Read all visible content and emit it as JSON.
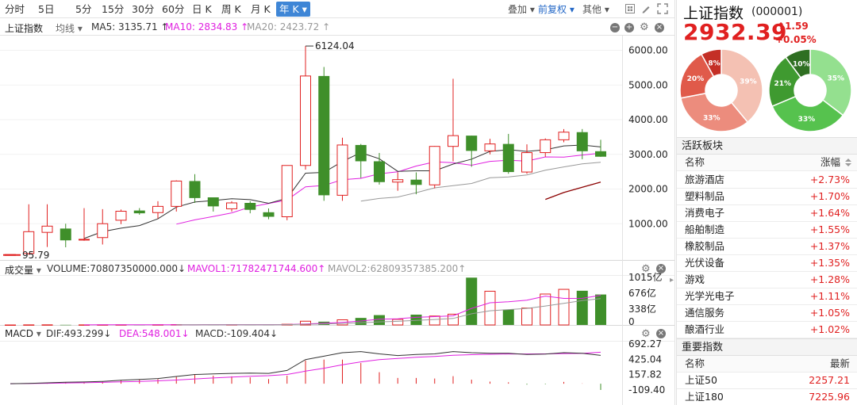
{
  "toolbar": {
    "tabs": [
      "分时",
      "5日",
      "5分",
      "15分",
      "30分",
      "60分",
      "日 K",
      "周 K",
      "月 K"
    ],
    "active_tab": "年 K",
    "overlay": "叠加",
    "adjust": "前复权",
    "other": "其他"
  },
  "price_legend": {
    "name": "上证指数",
    "ma_menu": "均线",
    "ma5": "MA5: 3135.71 ↑",
    "ma10": "MA10: 2834.83 ↑",
    "ma20": "MA20: 2423.72 ↑"
  },
  "volume_legend": {
    "name": "成交量",
    "volume": "VOLUME:70807350000.000↓",
    "mavol1": "MAVOL1:71782471744.600↑",
    "mavol2": "MAVOL2:62809357385.200↑"
  },
  "macd_legend": {
    "name": "MACD",
    "dif": "DIF:493.299↓",
    "dea": "DEA:548.001↓",
    "macd": "MACD:-109.404↓"
  },
  "chart_data": {
    "type": "candlestick",
    "price_axis_ticks": [
      "6000.00",
      "5000.00",
      "4000.00",
      "3000.00",
      "2000.00",
      "1000.00"
    ],
    "ylim": [
      0,
      6400
    ],
    "high_label": "6124.04",
    "low_label": "95.79",
    "candles": [
      {
        "o": 96,
        "h": 96,
        "l": 96,
        "c": 110
      },
      {
        "o": 140,
        "h": 1560,
        "l": 100,
        "c": 770
      },
      {
        "o": 750,
        "h": 1560,
        "l": 330,
        "c": 930
      },
      {
        "o": 860,
        "h": 1000,
        "l": 320,
        "c": 520
      },
      {
        "o": 540,
        "h": 1450,
        "l": 510,
        "c": 550
      },
      {
        "o": 600,
        "h": 1420,
        "l": 400,
        "c": 1000
      },
      {
        "o": 1100,
        "h": 1410,
        "l": 990,
        "c": 1360
      },
      {
        "o": 1380,
        "h": 1450,
        "l": 1260,
        "c": 1300
      },
      {
        "o": 1320,
        "h": 1650,
        "l": 1150,
        "c": 1500
      },
      {
        "o": 1500,
        "h": 2250,
        "l": 1350,
        "c": 2230
      },
      {
        "o": 2230,
        "h": 2430,
        "l": 1600,
        "c": 1740
      },
      {
        "o": 1760,
        "h": 1760,
        "l": 1350,
        "c": 1500
      },
      {
        "o": 1430,
        "h": 1650,
        "l": 1350,
        "c": 1600
      },
      {
        "o": 1600,
        "h": 1650,
        "l": 1300,
        "c": 1400
      },
      {
        "o": 1330,
        "h": 1440,
        "l": 1130,
        "c": 1200
      },
      {
        "o": 1200,
        "h": 2650,
        "l": 1100,
        "c": 2680
      },
      {
        "o": 2680,
        "h": 6124,
        "l": 2560,
        "c": 5260
      },
      {
        "o": 5260,
        "h": 5520,
        "l": 1660,
        "c": 1820
      },
      {
        "o": 1820,
        "h": 3480,
        "l": 1660,
        "c": 3270
      },
      {
        "o": 3270,
        "h": 3300,
        "l": 2320,
        "c": 2800
      },
      {
        "o": 2800,
        "h": 3040,
        "l": 2130,
        "c": 2200
      },
      {
        "o": 2200,
        "h": 2480,
        "l": 1950,
        "c": 2270
      },
      {
        "o": 2270,
        "h": 2480,
        "l": 1850,
        "c": 2120
      },
      {
        "o": 2120,
        "h": 3240,
        "l": 2020,
        "c": 3230
      },
      {
        "o": 3230,
        "h": 5180,
        "l": 2800,
        "c": 3540
      },
      {
        "o": 3540,
        "h": 3540,
        "l": 2640,
        "c": 3100
      },
      {
        "o": 3100,
        "h": 3450,
        "l": 3000,
        "c": 3300
      },
      {
        "o": 3300,
        "h": 3590,
        "l": 2440,
        "c": 2490
      },
      {
        "o": 2490,
        "h": 3290,
        "l": 2440,
        "c": 3050
      },
      {
        "o": 3050,
        "h": 3460,
        "l": 2930,
        "c": 3420
      },
      {
        "o": 3420,
        "h": 3730,
        "l": 3350,
        "c": 3640
      },
      {
        "o": 3640,
        "h": 3730,
        "l": 2860,
        "c": 3090
      },
      {
        "o": 3090,
        "h": 3420,
        "l": 2930,
        "c": 2932
      }
    ],
    "ma5": [
      null,
      null,
      null,
      null,
      574,
      772,
      872,
      946,
      1141,
      1478,
      1626,
      1668,
      1720,
      1694,
      1588,
      1733,
      2457,
      2479,
      2796,
      3050,
      2874,
      2509,
      2526,
      2526,
      2720,
      2862,
      3085,
      3134,
      3086,
      3132,
      3244,
      3269,
      3213
    ],
    "ma10": [
      null,
      null,
      null,
      null,
      null,
      null,
      null,
      null,
      null,
      988,
      1112,
      1208,
      1312,
      1482,
      1582,
      1685,
      2063,
      2102,
      2269,
      2309,
      2438,
      2495,
      2662,
      2781,
      2761,
      2686,
      2797,
      2830,
      2806,
      2926,
      2922,
      2980,
      3035
    ],
    "ma20": [
      null,
      null,
      null,
      null,
      null,
      null,
      null,
      null,
      null,
      null,
      null,
      null,
      null,
      null,
      null,
      null,
      null,
      null,
      null,
      1652,
      1727,
      1769,
      1894,
      2034,
      2095,
      2161,
      2325,
      2347,
      2406,
      2541,
      2638,
      2725,
      2772
    ],
    "ma30": [
      null,
      null,
      null,
      null,
      null,
      null,
      null,
      null,
      null,
      null,
      null,
      null,
      null,
      null,
      null,
      null,
      null,
      null,
      null,
      null,
      null,
      null,
      null,
      null,
      null,
      null,
      null,
      null,
      null,
      1700,
      1900,
      2050,
      2200
    ],
    "volume_axis_ticks": [
      "1015亿",
      "676亿",
      "338亿",
      "0"
    ],
    "volume": [
      0,
      2,
      3,
      3,
      2,
      3,
      4,
      4,
      5,
      8,
      7,
      6,
      7,
      6,
      6,
      15,
      80,
      70,
      110,
      150,
      210,
      120,
      220,
      190,
      230,
      1010,
      720,
      330,
      360,
      660,
      760,
      730,
      650
    ],
    "macd_axis_ticks": [
      "692.27",
      "425.04",
      "157.82",
      "-109.40"
    ],
    "dif": [
      0,
      5,
      15,
      25,
      30,
      40,
      60,
      75,
      90,
      125,
      160,
      170,
      180,
      185,
      180,
      230,
      420,
      480,
      540,
      560,
      520,
      490,
      510,
      520,
      560,
      540,
      530,
      530,
      510,
      515,
      540,
      530,
      493
    ],
    "dea": [
      0,
      2,
      7,
      12,
      17,
      23,
      31,
      40,
      50,
      64,
      83,
      100,
      116,
      130,
      140,
      160,
      218,
      270,
      330,
      380,
      420,
      440,
      460,
      475,
      495,
      505,
      512,
      518,
      518,
      520,
      525,
      528,
      548
    ],
    "macd": [
      0,
      6,
      16,
      26,
      26,
      34,
      58,
      70,
      80,
      122,
      154,
      140,
      128,
      110,
      80,
      140,
      404,
      420,
      420,
      360,
      200,
      100,
      100,
      90,
      130,
      70,
      36,
      24,
      -16,
      -10,
      30,
      4,
      -109
    ]
  },
  "right_panel": {
    "title": "上证指数",
    "code": "(000001)",
    "price": "2932.39",
    "change": "1.59",
    "change_arrow": "↑",
    "change_pct": "+0.05%",
    "donut_left_labels": [
      "8%",
      "20%",
      "33%",
      "39%"
    ],
    "donut_right_labels": [
      "10%",
      "21%",
      "33%",
      "35%"
    ],
    "active_sectors_title": "活跃板块",
    "sector_header_name": "名称",
    "sector_header_change": "涨幅",
    "sectors": [
      {
        "name": "旅游酒店",
        "change": "+2.73%"
      },
      {
        "name": "塑料制品",
        "change": "+1.70%"
      },
      {
        "name": "消费电子",
        "change": "+1.64%"
      },
      {
        "name": "船舶制造",
        "change": "+1.55%"
      },
      {
        "name": "橡胶制品",
        "change": "+1.37%"
      },
      {
        "name": "光伏设备",
        "change": "+1.35%"
      },
      {
        "name": "游戏",
        "change": "+1.28%"
      },
      {
        "name": "光学光电子",
        "change": "+1.11%"
      },
      {
        "name": "通信服务",
        "change": "+1.05%"
      },
      {
        "name": "酿酒行业",
        "change": "+1.02%"
      }
    ],
    "indices_title": "重要指数",
    "index_header_name": "名称",
    "index_header_latest": "最新",
    "indices": [
      {
        "name": "上证50",
        "latest": "2257.21"
      },
      {
        "name": "上证180",
        "latest": "7225.96"
      }
    ]
  },
  "colors": {
    "up": "#e02020",
    "down": "#3f8f2a",
    "ma5": "#333333",
    "ma10": "#e020e0",
    "ma20": "#999999",
    "ma30": "#8b0000",
    "accent": "#3f86d6"
  }
}
